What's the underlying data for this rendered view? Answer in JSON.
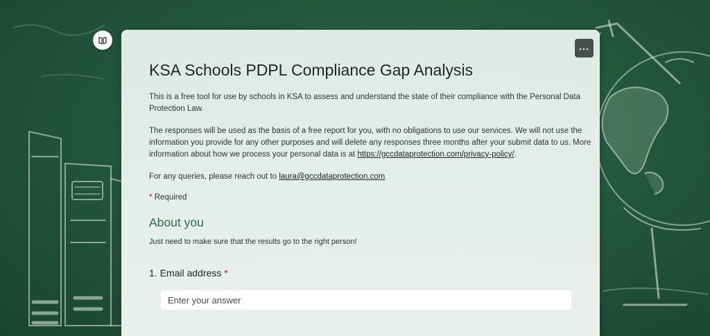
{
  "form": {
    "title": "KSA Schools PDPL Compliance Gap Analysis",
    "description_1": "This is a free tool for use by schools in KSA to assess and understand the state of their compliance with the Personal Data Protection Law.",
    "description_2_text": "The responses will be used as the basis of a free report for you, with no obligations to use our services. We will not use the information you provide for any other purposes and will delete any responses three months after your submit data to us. More information about how we process your personal data is at ",
    "description_2_link": "https://gccdataprotection.com/privacy-policy/",
    "description_2_end": ".",
    "description_3_text": "For any queries, please reach out to ",
    "description_3_link": "laura@gccdataprotection.com",
    "required_star": "*",
    "required_label": "Required"
  },
  "section": {
    "title": "About you",
    "description": "Just need to make sure that the results go to the right person!"
  },
  "questions": [
    {
      "number": "1.",
      "label": "Email address",
      "required_star": "*",
      "placeholder": "Enter your answer"
    }
  ],
  "controls": {
    "more_glyph": "...",
    "immersive_icon": "immersive-reader-icon",
    "more_icon": "more-options-icon"
  },
  "colors": {
    "chalkboard": "#24573f",
    "section_accent": "#2b6a4d",
    "required_red": "#a4262c"
  }
}
